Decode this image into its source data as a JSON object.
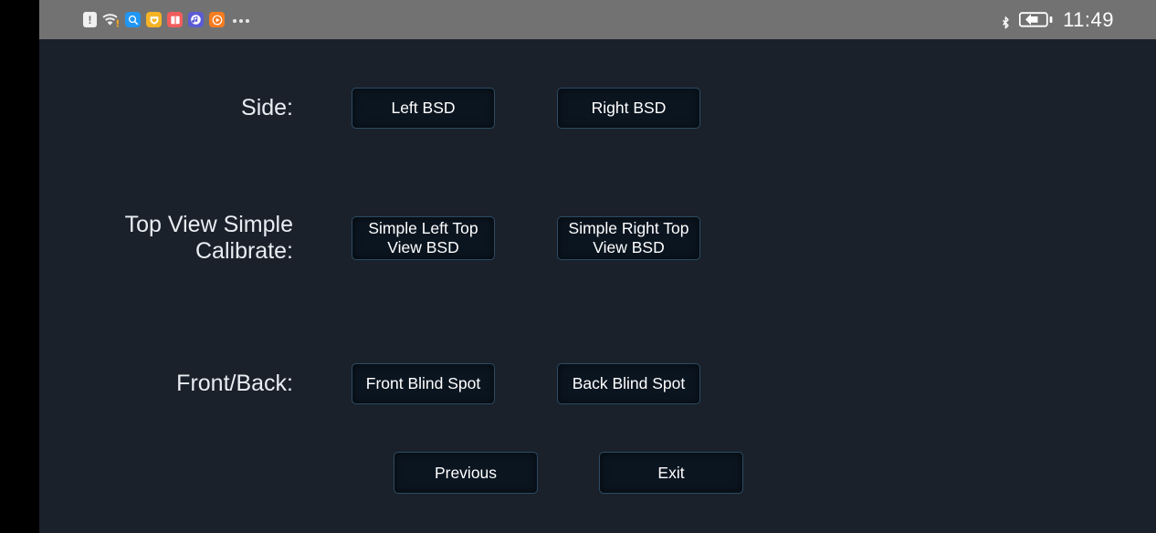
{
  "status_bar": {
    "left_icons": [
      {
        "name": "alert-icon",
        "glyph": "!"
      },
      {
        "name": "wifi-icon",
        "glyph": ""
      },
      {
        "name": "search-app-icon",
        "glyph": ""
      },
      {
        "name": "shield-app-icon",
        "glyph": ""
      },
      {
        "name": "book-app-icon",
        "glyph": ""
      },
      {
        "name": "music-app-icon",
        "glyph": ""
      },
      {
        "name": "video-app-icon",
        "glyph": ""
      },
      {
        "name": "overflow-icon",
        "glyph": "…"
      }
    ],
    "bluetooth_icon": "bluetooth-icon",
    "battery_icon": "battery-charging-icon",
    "clock": "11:49",
    "background_color": "#727272",
    "text_color": "#ffffff"
  },
  "theme": {
    "page_background": "#1a212b",
    "bezel": "#000000",
    "button_fill": "#0b1520",
    "button_border": "#2c4b63",
    "label_color": "#e9edf2"
  },
  "form": {
    "rows": [
      {
        "label": "Side:",
        "buttons": [
          {
            "label": "Left BSD"
          },
          {
            "label": "Right BSD"
          }
        ]
      },
      {
        "label": "Top View Simple Calibrate:",
        "label_line1": "Top View Simple",
        "label_line2": "Calibrate:",
        "buttons": [
          {
            "label": "Simple Left Top View BSD",
            "line1": "Simple Left Top",
            "line2": "View BSD"
          },
          {
            "label": "Simple Right Top View BSD",
            "line1": "Simple Right Top",
            "line2": "View BSD"
          }
        ]
      },
      {
        "label": "Front/Back:",
        "buttons": [
          {
            "label": "Front Blind Spot"
          },
          {
            "label": "Back Blind Spot"
          }
        ]
      }
    ]
  },
  "navigation": {
    "previous_label": "Previous",
    "exit_label": "Exit"
  }
}
